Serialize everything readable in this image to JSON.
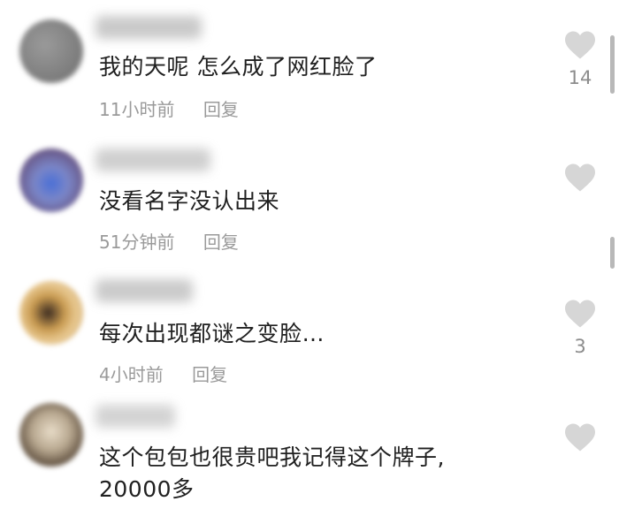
{
  "comments": [
    {
      "text": "我的天呢 怎么成了网红脸了",
      "time": "11小时前",
      "reply": "回复",
      "likes": "14"
    },
    {
      "text": "没看名字没认出来",
      "time": "51分钟前",
      "reply": "回复",
      "likes": ""
    },
    {
      "text": "每次出现都谜之变脸…",
      "time": "4小时前",
      "reply": "回复",
      "likes": "3"
    },
    {
      "text_line1": "这个包包也很贵吧我记得这个牌子,",
      "text_line2": "20000多",
      "likes": ""
    }
  ],
  "icons": {
    "like": "heart-icon"
  },
  "colors": {
    "heart": "#d6d6d6",
    "meta_text": "#9a9a9a"
  }
}
